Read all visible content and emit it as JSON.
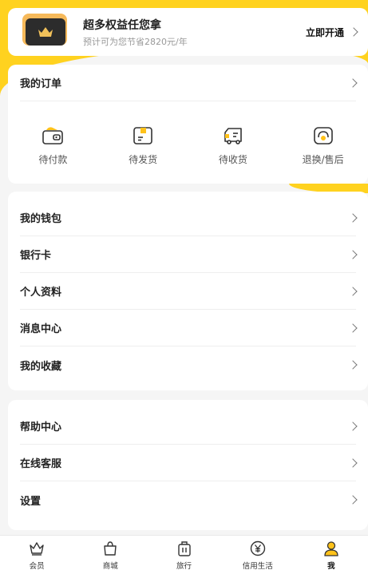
{
  "member": {
    "title": "超多权益任您拿",
    "subtitle": "预计可为您节省2820元/年",
    "cta": "立即开通"
  },
  "orders": {
    "title": "我的订单",
    "items": [
      {
        "label": "待付款",
        "icon": "wallet-icon"
      },
      {
        "label": "待发货",
        "icon": "package-icon"
      },
      {
        "label": "待收货",
        "icon": "truck-icon"
      },
      {
        "label": "退换/售后",
        "icon": "headset-icon"
      }
    ]
  },
  "menu1": [
    {
      "label": "我的钱包"
    },
    {
      "label": "银行卡"
    },
    {
      "label": "个人资料"
    },
    {
      "label": "消息中心"
    },
    {
      "label": "我的收藏"
    }
  ],
  "menu2": [
    {
      "label": "帮助中心"
    },
    {
      "label": "在线客服"
    },
    {
      "label": "设置"
    }
  ],
  "tabs": [
    {
      "label": "会员",
      "icon": "crown-icon"
    },
    {
      "label": "商城",
      "icon": "shopping-bag-icon"
    },
    {
      "label": "旅行",
      "icon": "luggage-icon"
    },
    {
      "label": "信用生活",
      "icon": "yen-icon"
    },
    {
      "label": "我",
      "icon": "user-icon",
      "active": true
    }
  ],
  "colors": {
    "accent": "#ffd21f",
    "accent_orange": "#f6b95a",
    "background": "#f5f5f5"
  }
}
